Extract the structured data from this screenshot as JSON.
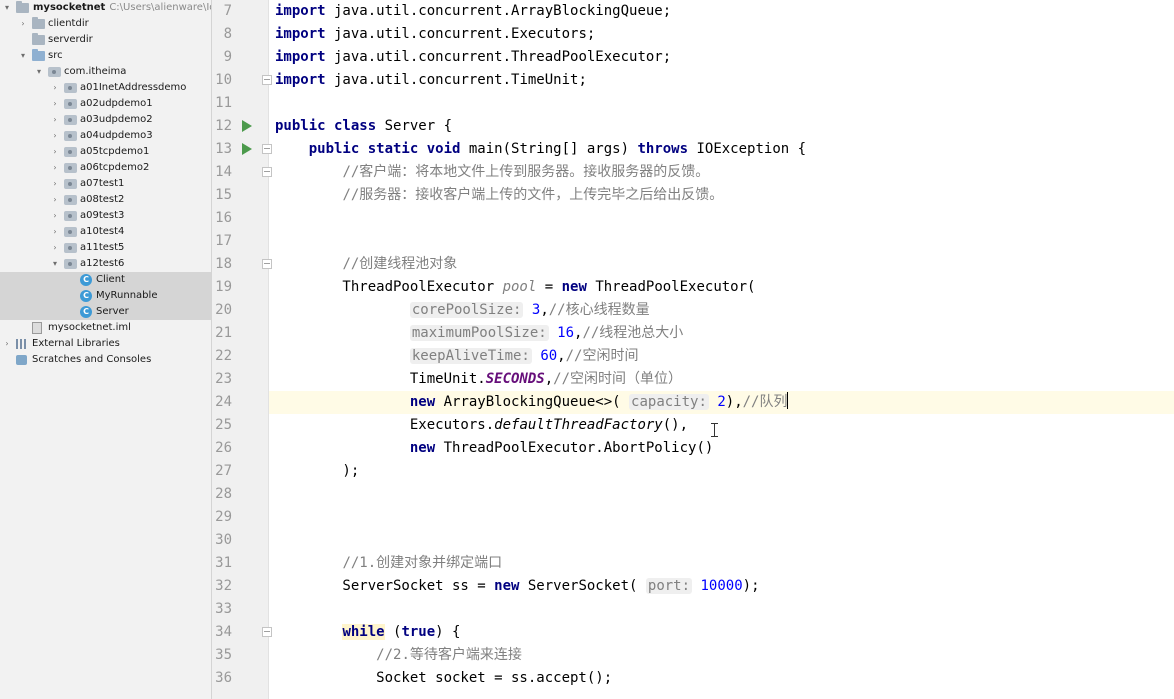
{
  "project_tree": {
    "root": {
      "name": "mysocketnet",
      "path": "C:\\Users\\alienware\\IdeaP"
    },
    "items": [
      {
        "label": "clientdir",
        "kind": "folder"
      },
      {
        "label": "serverdir",
        "kind": "folder"
      },
      {
        "label": "src",
        "kind": "folder-blue"
      },
      {
        "label": "com.itheima",
        "kind": "package"
      },
      {
        "label": "a01InetAddressdemo",
        "kind": "package"
      },
      {
        "label": "a02udpdemo1",
        "kind": "package"
      },
      {
        "label": "a03udpdemo2",
        "kind": "package"
      },
      {
        "label": "a04udpdemo3",
        "kind": "package"
      },
      {
        "label": "a05tcpdemo1",
        "kind": "package"
      },
      {
        "label": "a06tcpdemo2",
        "kind": "package"
      },
      {
        "label": "a07test1",
        "kind": "package"
      },
      {
        "label": "a08test2",
        "kind": "package"
      },
      {
        "label": "a09test3",
        "kind": "package"
      },
      {
        "label": "a10test4",
        "kind": "package"
      },
      {
        "label": "a11test5",
        "kind": "package"
      },
      {
        "label": "a12test6",
        "kind": "package"
      },
      {
        "label": "Client",
        "kind": "class"
      },
      {
        "label": "MyRunnable",
        "kind": "class"
      },
      {
        "label": "Server",
        "kind": "class"
      },
      {
        "label": "mysocketnet.iml",
        "kind": "iml"
      },
      {
        "label": "External Libraries",
        "kind": "libraries"
      },
      {
        "label": "Scratches and Consoles",
        "kind": "scratches"
      }
    ],
    "class_icon_letter": "C",
    "expand_glyph": "▾",
    "collapse_glyph": "›"
  },
  "editor": {
    "line_numbers": [
      "7",
      "8",
      "9",
      "10",
      "11",
      "12",
      "13",
      "14",
      "15",
      "16",
      "17",
      "18",
      "19",
      "20",
      "21",
      "22",
      "23",
      "24",
      "25",
      "26",
      "27",
      "28",
      "29",
      "30",
      "31",
      "32",
      "33",
      "34",
      "35",
      "36"
    ],
    "current_line": "24",
    "lines": [
      {
        "n": "7",
        "tokens": [
          {
            "t": "import",
            "k": "kw"
          },
          {
            "t": " java.util.concurrent.ArrayBlockingQueue;",
            "k": ""
          }
        ]
      },
      {
        "n": "8",
        "tokens": [
          {
            "t": "import",
            "k": "kw"
          },
          {
            "t": " java.util.concurrent.Executors;",
            "k": ""
          }
        ]
      },
      {
        "n": "9",
        "tokens": [
          {
            "t": "import",
            "k": "kw"
          },
          {
            "t": " java.util.concurrent.ThreadPoolExecutor;",
            "k": ""
          }
        ]
      },
      {
        "n": "10",
        "tokens": [
          {
            "t": "import",
            "k": "kw"
          },
          {
            "t": " java.util.concurrent.TimeUnit;",
            "k": ""
          }
        ]
      },
      {
        "n": "11",
        "tokens": []
      },
      {
        "n": "12",
        "tokens": [
          {
            "t": "public class",
            "k": "kw"
          },
          {
            "t": " Server {",
            "k": ""
          }
        ]
      },
      {
        "n": "13",
        "tokens": [
          {
            "t": "    ",
            "k": ""
          },
          {
            "t": "public static void",
            "k": "kw"
          },
          {
            "t": " main(String[] args) ",
            "k": ""
          },
          {
            "t": "throws",
            "k": "kw"
          },
          {
            "t": " IOException {",
            "k": ""
          }
        ]
      },
      {
        "n": "14",
        "tokens": [
          {
            "t": "        ",
            "k": ""
          },
          {
            "t": "//客户端：将本地文件上传到服务器。接收服务器的反馈。",
            "k": "cm cjk"
          }
        ]
      },
      {
        "n": "15",
        "tokens": [
          {
            "t": "        ",
            "k": ""
          },
          {
            "t": "//服务器：接收客户端上传的文件，上传完毕之后给出反馈。",
            "k": "cm cjk"
          }
        ]
      },
      {
        "n": "16",
        "tokens": []
      },
      {
        "n": "17",
        "tokens": []
      },
      {
        "n": "18",
        "tokens": [
          {
            "t": "        ",
            "k": ""
          },
          {
            "t": "//创建线程池对象",
            "k": "cm cjk"
          }
        ]
      },
      {
        "n": "19",
        "tokens": [
          {
            "t": "        ThreadPoolExecutor ",
            "k": ""
          },
          {
            "t": "pool",
            "k": "cm"
          },
          {
            "t": " = ",
            "k": ""
          },
          {
            "t": "new",
            "k": "kw"
          },
          {
            "t": " ThreadPoolExecutor(",
            "k": ""
          }
        ]
      },
      {
        "n": "20",
        "tokens": [
          {
            "t": "                ",
            "k": ""
          },
          {
            "t": "corePoolSize:",
            "k": "hint"
          },
          {
            "t": " ",
            "k": ""
          },
          {
            "t": "3",
            "k": "num"
          },
          {
            "t": ",",
            "k": ""
          },
          {
            "t": "//核心线程数量",
            "k": "cm cjk"
          }
        ]
      },
      {
        "n": "21",
        "tokens": [
          {
            "t": "                ",
            "k": ""
          },
          {
            "t": "maximumPoolSize:",
            "k": "hint"
          },
          {
            "t": " ",
            "k": ""
          },
          {
            "t": "16",
            "k": "num"
          },
          {
            "t": ",",
            "k": ""
          },
          {
            "t": "//线程池总大小",
            "k": "cm cjk"
          }
        ]
      },
      {
        "n": "22",
        "tokens": [
          {
            "t": "                ",
            "k": ""
          },
          {
            "t": "keepAliveTime:",
            "k": "hint"
          },
          {
            "t": " ",
            "k": ""
          },
          {
            "t": "60",
            "k": "num"
          },
          {
            "t": ",",
            "k": ""
          },
          {
            "t": "//空闲时间",
            "k": "cm cjk"
          }
        ]
      },
      {
        "n": "23",
        "tokens": [
          {
            "t": "                TimeUnit.",
            "k": ""
          },
          {
            "t": "SECONDS",
            "k": "ital-field"
          },
          {
            "t": ",",
            "k": ""
          },
          {
            "t": "//空闲时间（单位）",
            "k": "cm cjk"
          }
        ]
      },
      {
        "n": "24",
        "tokens": [
          {
            "t": "                ",
            "k": ""
          },
          {
            "t": "new",
            "k": "kw"
          },
          {
            "t": " ArrayBlockingQueue<>( ",
            "k": ""
          },
          {
            "t": "capacity:",
            "k": "hint"
          },
          {
            "t": " ",
            "k": ""
          },
          {
            "t": "2",
            "k": "num"
          },
          {
            "t": "),",
            "k": ""
          },
          {
            "t": "//队列",
            "k": "cm cjk"
          },
          {
            "t": "",
            "k": "caret"
          }
        ]
      },
      {
        "n": "25",
        "tokens": [
          {
            "t": "                Executors.",
            "k": ""
          },
          {
            "t": "defaultThreadFactory",
            "k": "it"
          },
          {
            "t": "(),",
            "k": ""
          }
        ]
      },
      {
        "n": "26",
        "tokens": [
          {
            "t": "                ",
            "k": ""
          },
          {
            "t": "new",
            "k": "kw"
          },
          {
            "t": " ThreadPoolExecutor.AbortPolicy()",
            "k": ""
          }
        ]
      },
      {
        "n": "27",
        "tokens": [
          {
            "t": "        );",
            "k": ""
          }
        ]
      },
      {
        "n": "28",
        "tokens": []
      },
      {
        "n": "29",
        "tokens": []
      },
      {
        "n": "30",
        "tokens": []
      },
      {
        "n": "31",
        "tokens": [
          {
            "t": "        ",
            "k": ""
          },
          {
            "t": "//1.创建对象并绑定端口",
            "k": "cm cjk"
          }
        ]
      },
      {
        "n": "32",
        "tokens": [
          {
            "t": "        ServerSocket ss = ",
            "k": ""
          },
          {
            "t": "new",
            "k": "kw"
          },
          {
            "t": " ServerSocket( ",
            "k": ""
          },
          {
            "t": "port:",
            "k": "hint"
          },
          {
            "t": " ",
            "k": ""
          },
          {
            "t": "10000",
            "k": "num"
          },
          {
            "t": ");",
            "k": ""
          }
        ]
      },
      {
        "n": "33",
        "tokens": []
      },
      {
        "n": "34",
        "tokens": [
          {
            "t": "        ",
            "k": ""
          },
          {
            "t": "while",
            "k": "kw hl-while"
          },
          {
            "t": " (",
            "k": ""
          },
          {
            "t": "true",
            "k": "kw"
          },
          {
            "t": ") {",
            "k": ""
          }
        ]
      },
      {
        "n": "35",
        "tokens": [
          {
            "t": "            ",
            "k": ""
          },
          {
            "t": "//2.等待客户端来连接",
            "k": "cm cjk"
          }
        ]
      },
      {
        "n": "36",
        "tokens": [
          {
            "t": "            Socket socket = ss.accept();",
            "k": ""
          }
        ]
      }
    ],
    "run_markers": [
      "12",
      "13"
    ],
    "fold_markers": [
      "10",
      "13",
      "14",
      "18",
      "34"
    ]
  }
}
